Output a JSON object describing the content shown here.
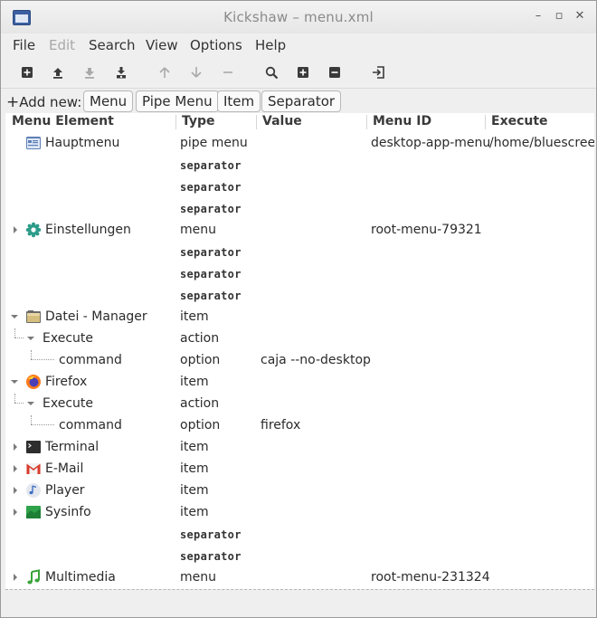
{
  "window": {
    "title": "Kickshaw – menu.xml"
  },
  "menubar": {
    "items": [
      {
        "label": "File",
        "enabled": true
      },
      {
        "label": "Edit",
        "enabled": false
      },
      {
        "label": "Search",
        "enabled": true
      },
      {
        "label": "View",
        "enabled": true
      },
      {
        "label": "Options",
        "enabled": true
      },
      {
        "label": "Help",
        "enabled": true
      }
    ]
  },
  "toolbar": {
    "buttons": [
      {
        "icon": "new-file-icon"
      },
      {
        "icon": "move-top-icon"
      },
      {
        "icon": "move-bottom-icon"
      },
      {
        "icon": "save-as-icon"
      },
      {
        "icon": "arrow-up-icon"
      },
      {
        "icon": "arrow-down-icon"
      },
      {
        "icon": "remove-icon"
      },
      {
        "icon": "search-icon"
      },
      {
        "icon": "expand-all-icon"
      },
      {
        "icon": "collapse-all-icon"
      },
      {
        "icon": "quit-icon"
      }
    ]
  },
  "addbar": {
    "label": "Add new:",
    "buttons": [
      "Menu",
      "Pipe Menu",
      "Item",
      "Separator"
    ]
  },
  "tree": {
    "columns": [
      "Menu Element",
      "Type",
      "Value",
      "Menu ID",
      "Execute"
    ],
    "rows": [
      {
        "element": "Hauptmenu",
        "type": "pipe menu",
        "value": "",
        "menu_id": "desktop-app-menu",
        "execute": "/home/bluescreen",
        "icon": "app-menu-icon"
      },
      {
        "element": "",
        "type": "separator",
        "value": "",
        "menu_id": "",
        "execute": ""
      },
      {
        "element": "",
        "type": "separator",
        "value": "",
        "menu_id": "",
        "execute": ""
      },
      {
        "element": "",
        "type": "separator",
        "value": "",
        "menu_id": "",
        "execute": ""
      },
      {
        "element": "Einstellungen",
        "type": "menu",
        "value": "",
        "menu_id": "root-menu-79321",
        "execute": "",
        "icon": "settings-gear-icon"
      },
      {
        "element": "",
        "type": "separator",
        "value": "",
        "menu_id": "",
        "execute": ""
      },
      {
        "element": "",
        "type": "separator",
        "value": "",
        "menu_id": "",
        "execute": ""
      },
      {
        "element": "",
        "type": "separator",
        "value": "",
        "menu_id": "",
        "execute": ""
      },
      {
        "element": "Datei - Manager",
        "type": "item",
        "value": "",
        "menu_id": "",
        "execute": "",
        "icon": "file-manager-icon"
      },
      {
        "element": "Execute",
        "type": "action",
        "value": "",
        "menu_id": "",
        "execute": ""
      },
      {
        "element": "command",
        "type": "option",
        "value": "caja --no-desktop",
        "menu_id": "",
        "execute": ""
      },
      {
        "element": "Firefox",
        "type": "item",
        "value": "",
        "menu_id": "",
        "execute": "",
        "icon": "firefox-icon"
      },
      {
        "element": "Execute",
        "type": "action",
        "value": "",
        "menu_id": "",
        "execute": ""
      },
      {
        "element": "command",
        "type": "option",
        "value": "firefox",
        "menu_id": "",
        "execute": ""
      },
      {
        "element": "Terminal",
        "type": "item",
        "value": "",
        "menu_id": "",
        "execute": "",
        "icon": "terminal-icon"
      },
      {
        "element": "E-Mail",
        "type": "item",
        "value": "",
        "menu_id": "",
        "execute": "",
        "icon": "gmail-icon"
      },
      {
        "element": "Player",
        "type": "item",
        "value": "",
        "menu_id": "",
        "execute": "",
        "icon": "music-player-icon"
      },
      {
        "element": "Sysinfo",
        "type": "item",
        "value": "",
        "menu_id": "",
        "execute": "",
        "icon": "system-monitor-icon"
      },
      {
        "element": "",
        "type": "separator",
        "value": "",
        "menu_id": "",
        "execute": ""
      },
      {
        "element": "",
        "type": "separator",
        "value": "",
        "menu_id": "",
        "execute": ""
      },
      {
        "element": "Multimedia",
        "type": "menu",
        "value": "",
        "menu_id": "root-menu-231324",
        "execute": "",
        "icon": "multimedia-note-icon"
      }
    ]
  }
}
